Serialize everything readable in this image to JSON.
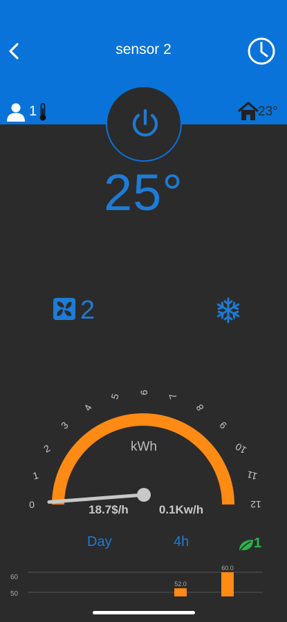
{
  "header": {
    "title": "sensor 2",
    "back_icon": "chevron-left-icon",
    "history_icon": "clock-icon"
  },
  "status": {
    "occupants": "1",
    "home_temp": "23°"
  },
  "control": {
    "power_icon": "power-icon",
    "setpoint": "25°",
    "fan_speed": "2",
    "mode_icon": "snowflake-icon"
  },
  "gauge": {
    "unit": "kWh",
    "scale": [
      "0",
      "1",
      "2",
      "3",
      "4",
      "5",
      "6",
      "7",
      "8",
      "9",
      "10",
      "11",
      "12"
    ],
    "min": 0,
    "max": 12,
    "needle_value": 0.1,
    "cost": "18.7$/h",
    "power": "0.1Kw/h"
  },
  "range": {
    "period": "Day",
    "window": "4h",
    "eco_level": "1"
  },
  "mini_chart": {
    "y_ticks": [
      "60",
      "50"
    ],
    "bars": [
      {
        "label": "52.0",
        "value": 52
      },
      {
        "label": "60.0",
        "value": 60
      }
    ]
  },
  "colors": {
    "header": "#0a73d9",
    "accent": "#1e7bd6",
    "gauge": "#ff8a14",
    "eco": "#2db34a",
    "background": "#2b2b2b"
  }
}
